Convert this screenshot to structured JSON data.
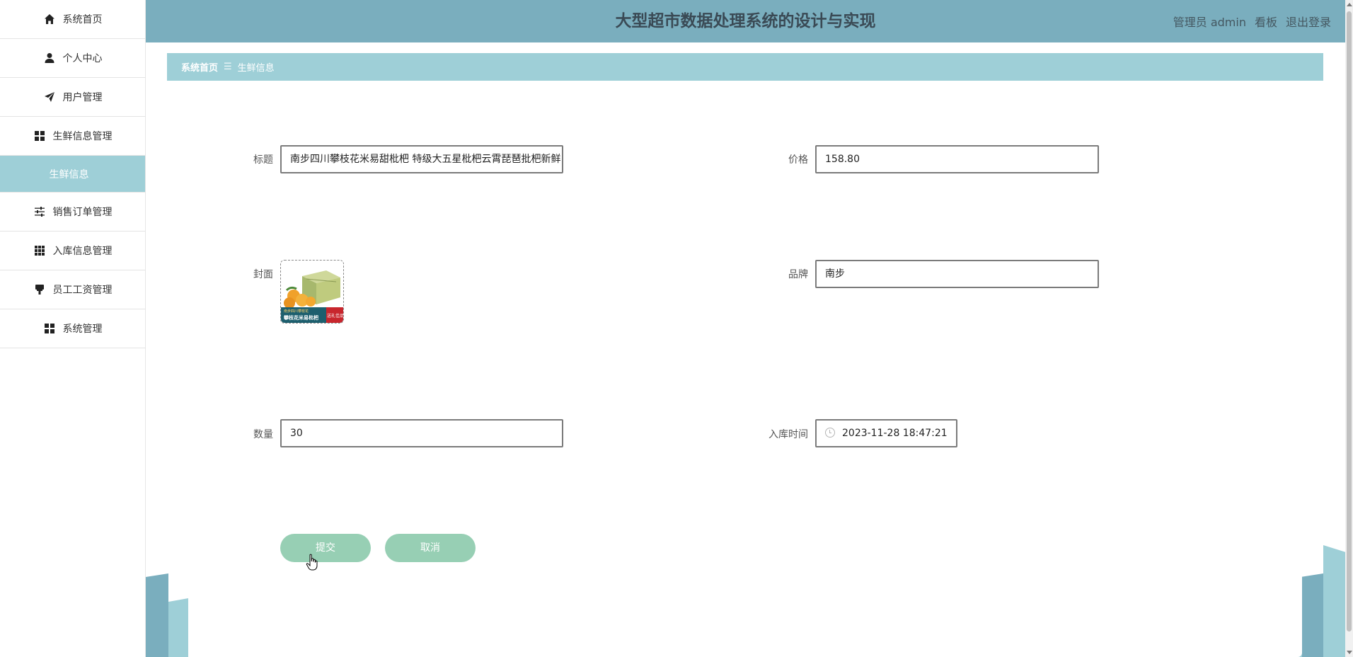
{
  "header": {
    "title": "大型超市数据处理系统的设计与实现",
    "user": "管理员 admin",
    "dashboard": "看板",
    "logout": "退出登录"
  },
  "sidebar": {
    "items": [
      {
        "label": "系统首页",
        "icon": "home-icon"
      },
      {
        "label": "个人中心",
        "icon": "user-icon"
      },
      {
        "label": "用户管理",
        "icon": "send-icon"
      },
      {
        "label": "生鲜信息管理",
        "icon": "grid-icon"
      },
      {
        "label": "销售订单管理",
        "icon": "sliders-icon"
      },
      {
        "label": "入库信息管理",
        "icon": "apps-icon"
      },
      {
        "label": "员工工资管理",
        "icon": "brush-icon"
      },
      {
        "label": "系统管理",
        "icon": "grid-icon"
      }
    ],
    "active_sub": "生鲜信息"
  },
  "breadcrumb": {
    "home": "系统首页",
    "separator": "☰",
    "current": "生鲜信息"
  },
  "form": {
    "title_label": "标题",
    "title_value": "南步四川攀枝花米易甜枇杷 特级大五星枇杷云霄琵琶批杷新鲜",
    "price_label": "价格",
    "price_value": "158.80",
    "cover_label": "封面",
    "brand_label": "品牌",
    "brand_value": "南步",
    "quantity_label": "数量",
    "quantity_value": "30",
    "stock_time_label": "入库时间",
    "stock_time_value": "2023-11-28 18:47:21",
    "submit_label": "提交",
    "cancel_label": "取消"
  },
  "cover_image": {
    "title_text": "攀枝花米易枇杷",
    "badge_text": "送礼佳品",
    "top_text": "南步四川攀枝花"
  },
  "colors": {
    "header_bg": "#7aaebe",
    "breadcrumb_bg": "#9ecfd7",
    "button_bg": "#97cfb4",
    "active_menu_bg": "#9ecfd7"
  }
}
